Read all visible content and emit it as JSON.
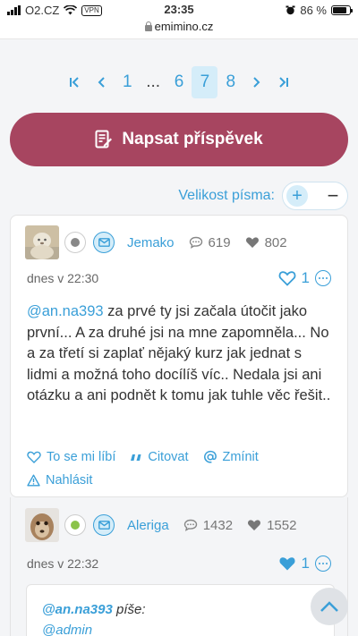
{
  "status_bar": {
    "carrier": "O2.CZ",
    "vpn": "VPN",
    "time": "23:35",
    "battery": "86 %",
    "battery_level": 0.86
  },
  "url": "emimino.cz",
  "pagination": {
    "first": "K",
    "prev": "<",
    "pages": [
      "1",
      "...",
      "6",
      "7",
      "8"
    ],
    "active": "7",
    "next": ">",
    "last": ">I"
  },
  "write_button": "Napsat příspěvek",
  "font_size": {
    "label": "Velikost písma:",
    "plus": "+",
    "minus": "−"
  },
  "posts": [
    {
      "username": "Jemako",
      "status_color": "#888888",
      "comments": "619",
      "likes": "802",
      "date": "dnes v 22:30",
      "post_likes": "1",
      "mention": "@an.na393",
      "text": " za prvé ty jsi začala útočit jako první... A za druhé jsi na mne zapomněla... No a za třetí si zaplať nějaký kurz jak jednat s lidmi a možná toho docílíš víc.. Nedala jsi ani otázku a ani podnět k tomu jak tuhle věc řešit..",
      "actions": {
        "like": "To se mi líbí",
        "quote": "Citovat",
        "mention": "Zmínit",
        "report": "Nahlásit"
      }
    },
    {
      "username": "Aleriga",
      "status_color": "#8bc34a",
      "comments": "1432",
      "likes": "1552",
      "date": "dnes v 22:32",
      "post_likes": "1",
      "quote": {
        "author": "@an.na393",
        "writes": "píše:",
        "body": "@admin"
      }
    }
  ],
  "colors": {
    "accent": "#3a9fd8",
    "brand": "#a74560"
  }
}
